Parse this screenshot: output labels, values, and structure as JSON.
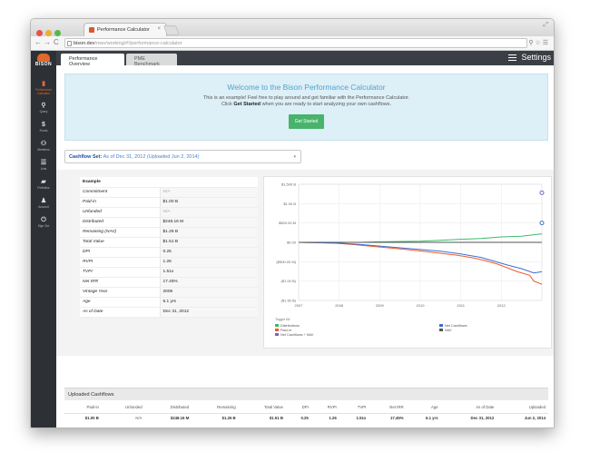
{
  "browser": {
    "tab_title": "Performance Calculator",
    "url_host": "bison.dev",
    "url_path": "/nwo/working/#!/performance-calculator",
    "colors": {
      "close": "#e5534b",
      "minimize": "#e8b22e",
      "maximize": "#55b94b"
    }
  },
  "sidebar": {
    "logo_text": "BISON",
    "items": [
      {
        "label": "Performance Calculator",
        "icon": "bar-chart-icon",
        "glyph": "▮"
      },
      {
        "label": "Query",
        "icon": "search-icon",
        "glyph": "⚲"
      },
      {
        "label": "Funds",
        "icon": "dollar-icon",
        "glyph": "$"
      },
      {
        "label": "Members",
        "icon": "users-icon",
        "glyph": "👥"
      },
      {
        "label": "Lists",
        "icon": "list-icon",
        "glyph": "☰"
      },
      {
        "label": "Portfolios",
        "icon": "folder-icon",
        "glyph": "▰"
      },
      {
        "label": "Account",
        "icon": "user-icon",
        "glyph": "♟"
      },
      {
        "label": "Sign Out",
        "icon": "power-icon",
        "glyph": "⏻"
      }
    ],
    "active_color": "#e0692c"
  },
  "topnav": {
    "tabs": [
      "Performance Overview",
      "PME Benchmark"
    ],
    "settings_label": "Settings"
  },
  "welcome": {
    "title": "Welcome to the Bison Performance Calculator",
    "line1": "This is an example! Feel free to play around and get familiar with the Performance Calculator.",
    "line2_pre": "Click ",
    "line2_bold": "Get Started",
    "line2_post": " when you are ready to start analyzing your own cashflows.",
    "button": "Get Started"
  },
  "cashflow_set": {
    "label": "Cashflow Set:",
    "value": "As of Dec 31, 2012 (Uploaded Jun 2, 2014)"
  },
  "stats": {
    "title": "Example",
    "rows": [
      {
        "k": "Commitment",
        "v": "N/A",
        "na": true
      },
      {
        "k": "Paid-in",
        "v": "$1.00 B"
      },
      {
        "k": "Unfunded",
        "v": "N/A",
        "na": true
      },
      {
        "k": "Distributed",
        "v": "$248.16 M"
      },
      {
        "k": "Remaining (NAV)",
        "v": "$1.26 B"
      },
      {
        "k": "Total Value",
        "v": "$1.51 B"
      },
      {
        "k": "DPI",
        "v": "0.25"
      },
      {
        "k": "RVPI",
        "v": "1.26"
      },
      {
        "k": "TVPI",
        "v": "1.51x"
      },
      {
        "k": "Net IRR",
        "v": "17.45%"
      },
      {
        "k": "Vintage Year",
        "v": "2006"
      },
      {
        "k": "Age",
        "v": "6.1 yrs"
      },
      {
        "k": "As of Date",
        "v": "Dec 31, 2012"
      }
    ]
  },
  "chart_data": {
    "type": "line",
    "x": [
      2007,
      2008,
      2009,
      2010,
      2011,
      2012
    ],
    "xlim": [
      2007,
      2013
    ],
    "y_ticks": [
      "$1,500 B",
      "$1.00 B",
      "$500.00 M",
      "$0.00",
      "($500.00 M)",
      "($1.00 B)",
      "($1.50 B)"
    ],
    "y_values": [
      1500,
      1000,
      500,
      0,
      -500,
      -1000,
      -1500
    ],
    "ylim": [
      -1500,
      1500
    ],
    "legend_title": "Toggle All",
    "legend": [
      "Distributions",
      "Paid-in",
      "Net Cashflows + NAV",
      "Net Cashflows",
      "NAV"
    ],
    "series": [
      {
        "name": "Distributions",
        "color": "#3cba6a",
        "points": [
          [
            2007,
            0
          ],
          [
            2008.5,
            0
          ],
          [
            2009,
            15
          ],
          [
            2010,
            30
          ],
          [
            2010.5,
            55
          ],
          [
            2011,
            80
          ],
          [
            2011.5,
            100
          ],
          [
            2012,
            140
          ],
          [
            2012.5,
            160
          ],
          [
            2013,
            220
          ]
        ]
      },
      {
        "name": "Paid-in",
        "color": "#f05a2a",
        "points": [
          [
            2007,
            0
          ],
          [
            2007.9,
            -20
          ],
          [
            2008.4,
            -60
          ],
          [
            2008.9,
            -110
          ],
          [
            2009.4,
            -160
          ],
          [
            2009.9,
            -210
          ],
          [
            2010.4,
            -270
          ],
          [
            2010.9,
            -330
          ],
          [
            2011.3,
            -400
          ],
          [
            2011.6,
            -470
          ],
          [
            2011.9,
            -560
          ],
          [
            2012.2,
            -680
          ],
          [
            2012.4,
            -760
          ],
          [
            2012.7,
            -850
          ],
          [
            2012.8,
            -1000
          ],
          [
            2013,
            -1080
          ]
        ]
      },
      {
        "name": "Net Cashflows + NAV",
        "color": "#7b63c7",
        "points": [
          [
            2013,
            1280
          ]
        ]
      },
      {
        "name": "Net Cashflows",
        "color": "#3a6fd1",
        "points": [
          [
            2007,
            0
          ],
          [
            2008,
            -20
          ],
          [
            2008.5,
            -55
          ],
          [
            2009,
            -95
          ],
          [
            2009.5,
            -140
          ],
          [
            2010,
            -185
          ],
          [
            2010.5,
            -230
          ],
          [
            2011,
            -300
          ],
          [
            2011.5,
            -390
          ],
          [
            2011.8,
            -480
          ],
          [
            2012.2,
            -600
          ],
          [
            2012.5,
            -680
          ],
          [
            2012.8,
            -790
          ],
          [
            2013,
            -760
          ]
        ]
      },
      {
        "name": "NAV",
        "color": "#555555",
        "points": [
          [
            2007,
            0
          ],
          [
            2013,
            0
          ]
        ]
      }
    ],
    "markers": [
      {
        "x": 2013,
        "y": 1280,
        "color": "#7b63c7"
      },
      {
        "x": 2013,
        "y": 500,
        "color": "#3a6fd1"
      }
    ]
  },
  "uploaded": {
    "title": "Uploaded Cashflows",
    "headers": [
      "Paid-in",
      "Unfunded",
      "Distributed",
      "Remaining",
      "Total Value",
      "DPI",
      "RVPI",
      "TVPI",
      "Net IRR",
      "Age",
      "As of Date",
      "Uploaded"
    ],
    "row": [
      "$1.00 B",
      "N/A",
      "$248.16 M",
      "$1.26 B",
      "$1.51 B",
      "0.25",
      "1.26",
      "1.51x",
      "17.45%",
      "6.1 yrs",
      "Dec 31, 2012",
      "Jun 2, 2014"
    ]
  }
}
